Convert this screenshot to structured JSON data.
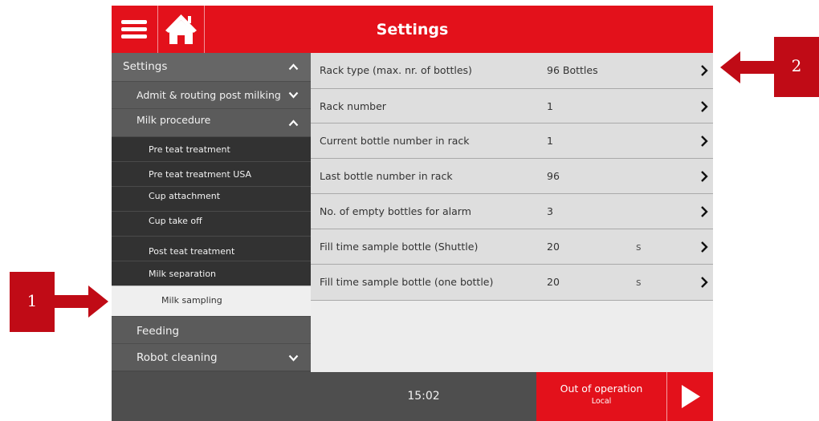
{
  "header": {
    "title": "Settings",
    "menu_icon": "hamburger-menu-icon",
    "home_icon": "home-icon"
  },
  "sidebar": {
    "items": [
      {
        "label": "Settings",
        "level": 0,
        "chevron": "up"
      },
      {
        "label": "Admit & routing post milking",
        "level": 1,
        "chevron": "down"
      },
      {
        "label": "Milk procedure",
        "level": 1,
        "chevron": "up"
      },
      {
        "label": "Pre teat treatment",
        "level": 2
      },
      {
        "label": "Pre teat treatment USA",
        "level": 2
      },
      {
        "label": "Cup attachment",
        "level": 2
      },
      {
        "label": "Cup take off",
        "level": 2
      },
      {
        "label": "Post teat treatment",
        "level": 2
      },
      {
        "label": "Milk separation",
        "level": 2
      },
      {
        "label": "Milk sampling",
        "level": 3,
        "selected": true
      },
      {
        "label": "Feeding",
        "level": 1
      },
      {
        "label": "Robot cleaning",
        "level": 1,
        "chevron": "down"
      }
    ]
  },
  "settings_rows": [
    {
      "label": "Rack type (max. nr. of bottles)",
      "value": "96 Bottles",
      "unit": ""
    },
    {
      "label": "Rack number",
      "value": "1",
      "unit": ""
    },
    {
      "label": "Current bottle number in rack",
      "value": "1",
      "unit": ""
    },
    {
      "label": "Last bottle number in rack",
      "value": "96",
      "unit": ""
    },
    {
      "label": "No. of empty bottles for alarm",
      "value": "3",
      "unit": ""
    },
    {
      "label": "Fill time sample bottle (Shuttle)",
      "value": "20",
      "unit": "s"
    },
    {
      "label": "Fill time sample bottle (one bottle)",
      "value": "20",
      "unit": "s"
    }
  ],
  "footer": {
    "time": "15:02",
    "status_main": "Out of operation",
    "status_sub": "Local",
    "play_icon": "play-icon"
  },
  "callouts": [
    {
      "number": "1"
    },
    {
      "number": "2"
    }
  ],
  "colors": {
    "accent_red": "#e3111b",
    "callout_red": "#c00b16",
    "sidebar_dark": "#323232",
    "sidebar_mid": "#5b5b5b",
    "row_bg": "#dedede"
  }
}
